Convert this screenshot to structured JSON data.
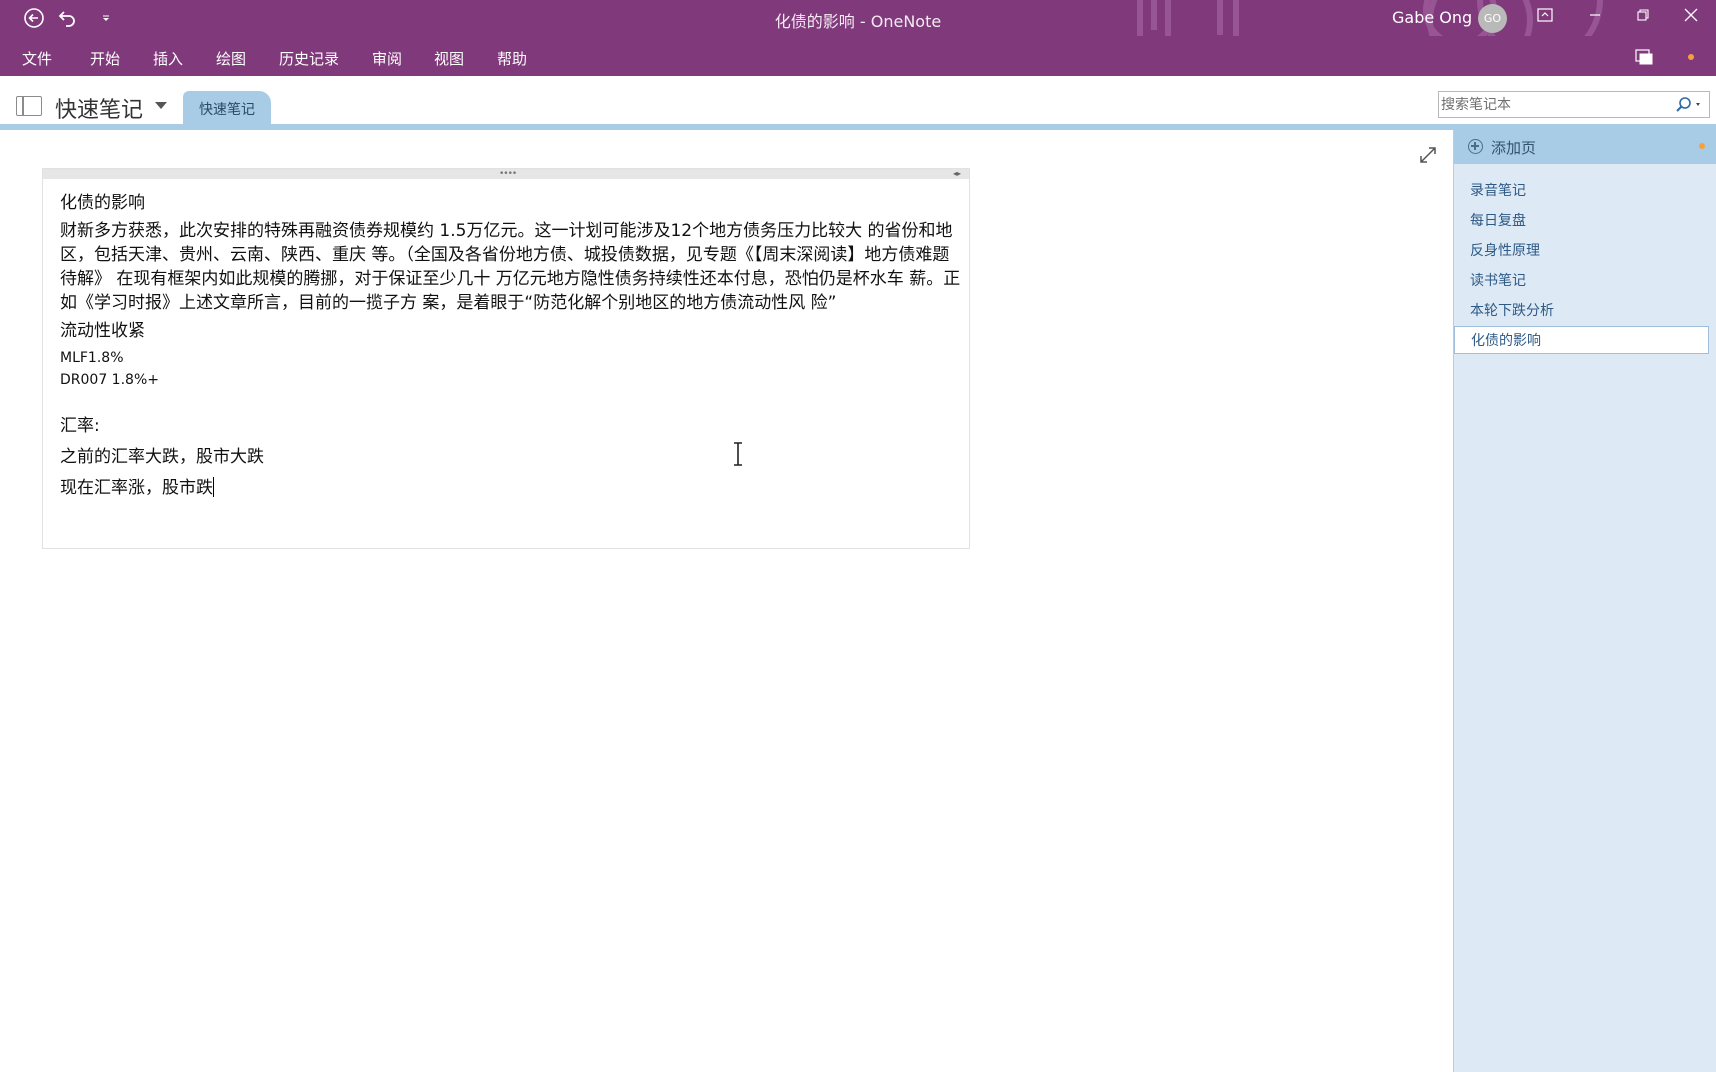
{
  "window": {
    "title": "化债的影响 - OneNote",
    "user_name": "Gabe Ong",
    "user_initials": "GO"
  },
  "ribbon": {
    "tabs": [
      "文件",
      "开始",
      "插入",
      "绘图",
      "历史记录",
      "审阅",
      "视图",
      "帮助"
    ]
  },
  "notebook": {
    "name": "快速笔记",
    "section_tab": "快速笔记"
  },
  "search": {
    "placeholder": "搜索笔记本"
  },
  "note": {
    "title": "化债的影响",
    "paragraph": "财新多方获悉，此次安排的特殊再融资债券规模约 1.5万亿元。这一计划可能涉及12个地方债务压力比较大 的省份和地区，包括天津、贵州、云南、陕西、重庆 等。（全国及各省份地方债、城投债数据，见专题《【周末深阅读】地方债难题待解》 在现有框架内如此规模的腾挪，对于保证至少几十 万亿元地方隐性债务持续性还本付息，恐怕仍是杯水车 薪。正如《学习时报》上述文章所言，目前的一揽子方 案，是着眼于“防范化解个别地区的地方债流动性风 险”",
    "heading2": "流动性收紧",
    "line_mlf": "MLF1.8%",
    "line_dr007": "DR007 1.8%+",
    "heading3": "汇率:",
    "line_before": "之前的汇率大跌，股市大跌",
    "line_now": "现在汇率涨，股市跌"
  },
  "pages_pane": {
    "add_page_label": "添加页",
    "pages": [
      "录音笔记",
      "每日复盘",
      "反身性原理",
      "读书笔记",
      "本轮下跌分析",
      "化债的影响"
    ],
    "selected_page": "化债的影响"
  },
  "colors": {
    "brand": "#80397b",
    "section": "#a8cbe6",
    "pages_bg": "#dde9f4",
    "accent_dot": "#f7a13a"
  },
  "icons": [
    "back-icon",
    "undo-icon",
    "qat-dropdown-icon",
    "minimize-icon",
    "restore-icon",
    "close-icon",
    "ribbon-display-icon",
    "share-icon",
    "notebook-icon",
    "search-icon",
    "expand-icon",
    "add-page-icon"
  ]
}
